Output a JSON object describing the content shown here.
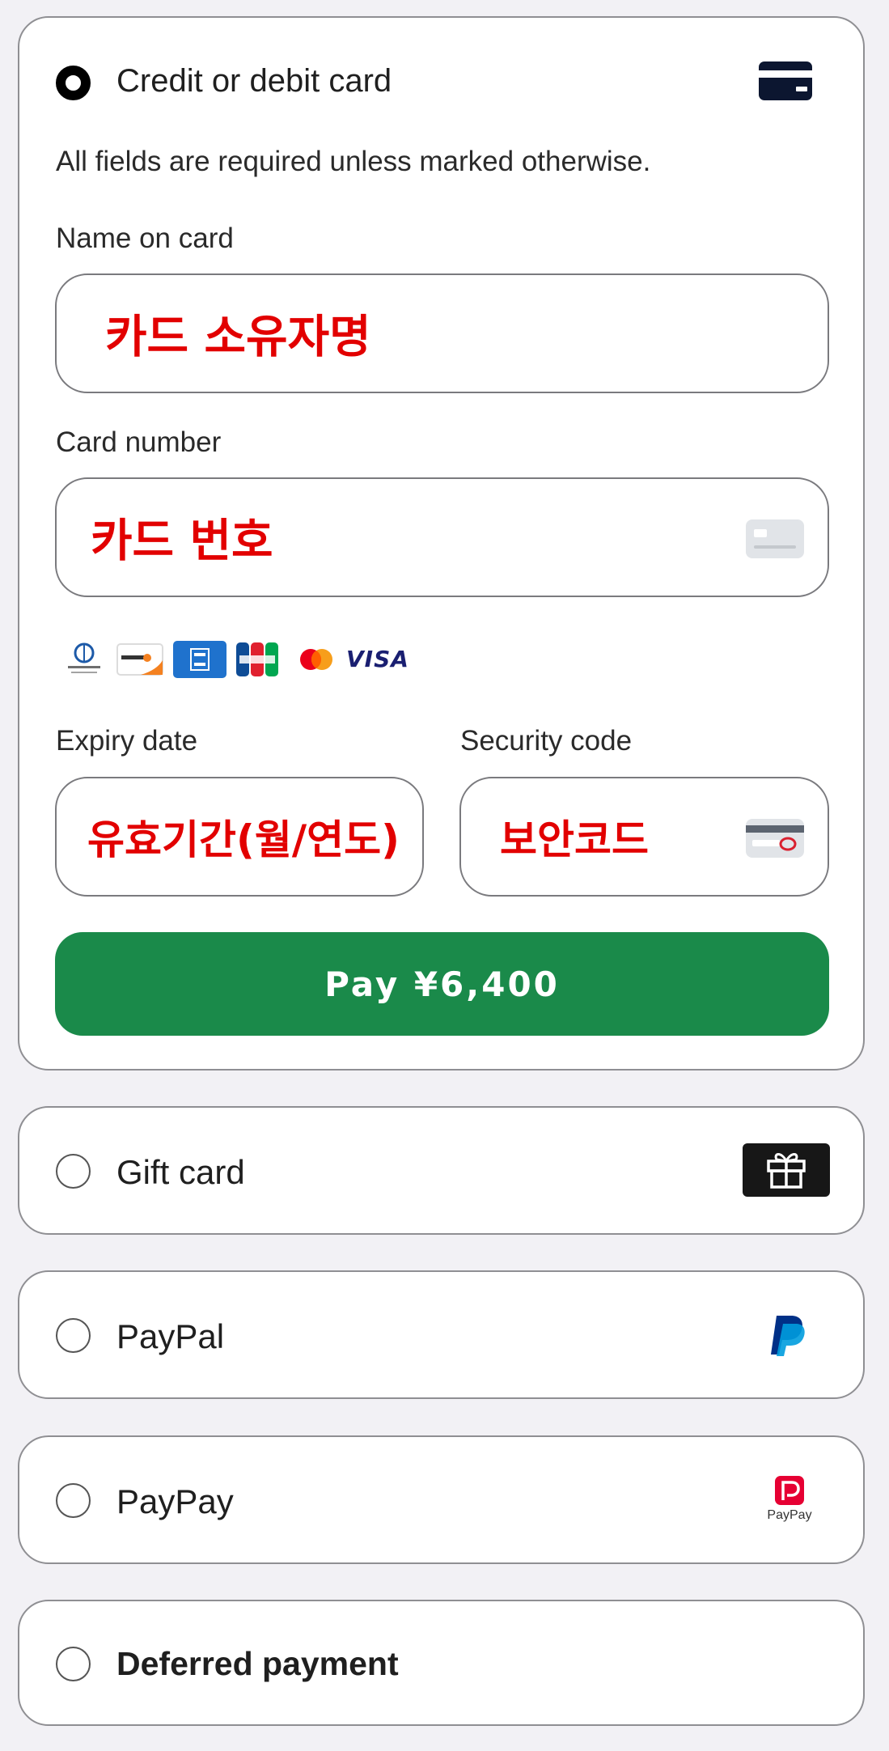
{
  "card_section": {
    "option_label": "Credit or debit card",
    "hint": "All fields are required unless marked otherwise.",
    "name_label": "Name on card",
    "name_value": "카드 소유자명",
    "number_label": "Card number",
    "number_value": "카드 번호",
    "brands": [
      "diners-club-icon",
      "discover-icon",
      "amex-icon",
      "jcb-icon",
      "mastercard-icon",
      "visa-icon"
    ],
    "visa_text": "VISA",
    "expiry_label": "Expiry date",
    "expiry_value": "유효기간(월/연도)",
    "security_label": "Security code",
    "security_value": "보안코드",
    "pay_label": "Pay ¥6,400"
  },
  "options": [
    {
      "label": "Gift card",
      "icon": "gift-icon"
    },
    {
      "label": "PayPal",
      "icon": "paypal-icon"
    },
    {
      "label": "PayPay",
      "icon": "paypay-icon",
      "icon_text": "PayPay"
    },
    {
      "label": "Deferred payment"
    }
  ],
  "colors": {
    "pay_button": "#1a8a4a",
    "placeholder_text": "#e20000",
    "background": "#f2f1f5",
    "paypal_dark": "#003087",
    "paypal_light": "#009cde",
    "paypay_red": "#e60033"
  }
}
